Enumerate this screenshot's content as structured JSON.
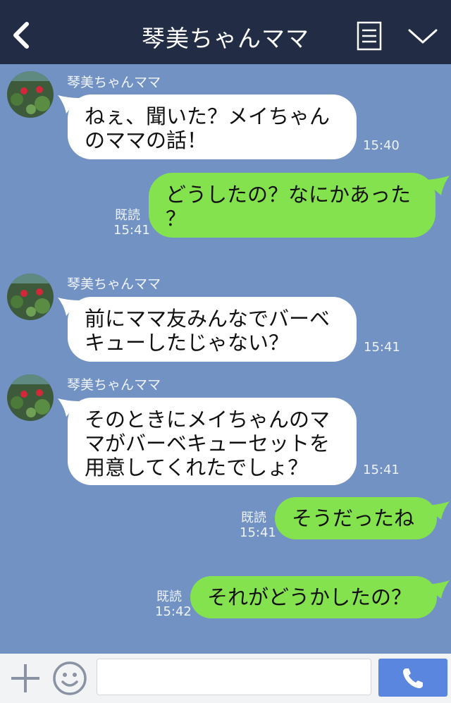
{
  "header": {
    "title": "琴美ちゃんママ"
  },
  "messages": [
    {
      "sender": "琴美ちゃんママ",
      "text": "ねぇ、聞いた？メイちゃん\nのママの話！",
      "time": "15:40"
    },
    {
      "read": "既読",
      "text": "どうしたの？なにかあった\n？",
      "time": "15:41"
    },
    {
      "sender": "琴美ちゃんママ",
      "text": "前にママ友みんなでバーベ\nキューしたじゃない？",
      "time": "15:41"
    },
    {
      "sender": "琴美ちゃんママ",
      "text": "そのときにメイちゃんのマ\nマがバーベキューセットを\n用意してくれたでしょ？",
      "time": "15:41"
    },
    {
      "read": "既読",
      "text": "そうだったね",
      "time": "15:41"
    },
    {
      "read": "既読",
      "text": "それがどうかしたの？",
      "time": "15:42"
    }
  ],
  "input": {
    "placeholder": ""
  },
  "colors": {
    "header": "#232c45",
    "chat_bg": "#7292c4",
    "incoming": "#ffffff",
    "outgoing": "#84e24e",
    "call": "#5b86e0"
  }
}
